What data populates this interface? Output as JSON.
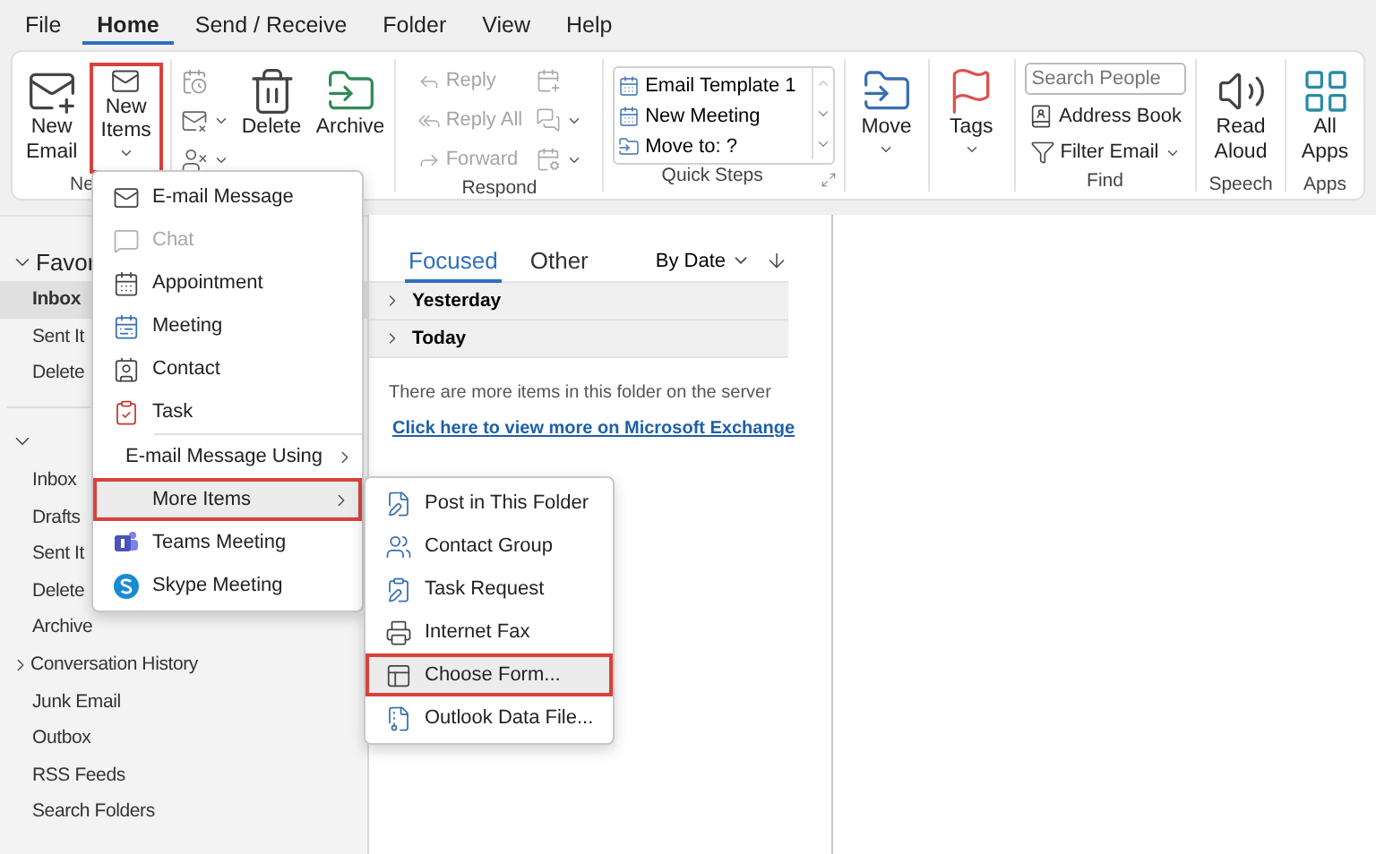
{
  "menu_bar": [
    {
      "label": "File",
      "selected": false
    },
    {
      "label": "Home",
      "selected": true
    },
    {
      "label": "Send / Receive",
      "selected": false
    },
    {
      "label": "Folder",
      "selected": false
    },
    {
      "label": "View",
      "selected": false
    },
    {
      "label": "Help",
      "selected": false
    }
  ],
  "ribbon": {
    "new": {
      "label": "Ne",
      "buttons": [
        {
          "label": "New Email",
          "dropdown": false,
          "highlighted": false
        },
        {
          "label": "New Items",
          "dropdown": true,
          "highlighted": true
        }
      ]
    },
    "delete": {
      "buttons": [
        {
          "label": "Delete"
        },
        {
          "label": "Archive"
        }
      ]
    },
    "respond": {
      "label": "Respond",
      "buttons": [
        {
          "label": "Reply",
          "disabled": true
        },
        {
          "label": "Reply All",
          "disabled": true
        },
        {
          "label": "Forward",
          "disabled": true
        }
      ]
    },
    "quick_steps": {
      "label": "Quick Steps",
      "items": [
        "Email Template 1",
        "New Meeting",
        "Move to: ?"
      ]
    },
    "move": {
      "button": "Move"
    },
    "tags": {
      "button": "Tags"
    },
    "find": {
      "label": "Find",
      "search": {
        "placeholder": "Search People"
      },
      "buttons": [
        {
          "label": "Address Book",
          "dropdown": false
        },
        {
          "label": "Filter Email",
          "dropdown": true
        }
      ]
    },
    "speech": {
      "label": "Speech",
      "button": "Read Aloud"
    },
    "apps": {
      "label": "Apps",
      "button": "All Apps"
    }
  },
  "sidebar": {
    "favorites": {
      "label": "Favor",
      "expanded": true,
      "items": [
        {
          "label": "Inbox",
          "selected": true,
          "expandable": false
        },
        {
          "label": "Sent It",
          "selected": false,
          "expandable": false
        },
        {
          "label": "Delete",
          "selected": false,
          "expandable": false
        }
      ]
    },
    "account": {
      "expanded": true,
      "items": [
        {
          "label": "Inbox",
          "selected": false,
          "expandable": false
        },
        {
          "label": "Drafts",
          "selected": false,
          "expandable": false
        },
        {
          "label": "Sent It",
          "selected": false,
          "expandable": false
        },
        {
          "label": "Delete",
          "selected": false,
          "expandable": false
        },
        {
          "label": "Archive",
          "selected": false,
          "expandable": false
        },
        {
          "label": "Conversation History",
          "selected": false,
          "expandable": true
        },
        {
          "label": "Junk Email",
          "selected": false,
          "expandable": false
        },
        {
          "label": "Outbox",
          "selected": false,
          "expandable": false
        },
        {
          "label": "RSS Feeds",
          "selected": false,
          "expandable": false
        },
        {
          "label": "Search Folders",
          "selected": false,
          "expandable": false
        }
      ]
    }
  },
  "message_list": {
    "tabs": [
      {
        "label": "Focused",
        "selected": true
      },
      {
        "label": "Other",
        "selected": false
      }
    ],
    "sort": "By Date",
    "groups": [
      {
        "label": "Yesterday",
        "expanded": false
      },
      {
        "label": "Today",
        "expanded": false
      }
    ],
    "notice": "There are more items in this folder on the server",
    "link": "Click here to view more on Microsoft Exchange"
  },
  "new_items_menu": {
    "items": [
      {
        "label": "E-mail Message",
        "disabled": false,
        "highlighted": false,
        "submenu": false
      },
      {
        "label": "Chat",
        "disabled": true,
        "highlighted": false,
        "submenu": false
      },
      {
        "label": "Appointment",
        "disabled": false,
        "highlighted": false,
        "submenu": false
      },
      {
        "label": "Meeting",
        "disabled": false,
        "highlighted": false,
        "submenu": false
      },
      {
        "label": "Contact",
        "disabled": false,
        "highlighted": false,
        "submenu": false
      },
      {
        "label": "Task",
        "disabled": false,
        "highlighted": false,
        "submenu": false
      },
      {
        "label": "E-mail Message Using",
        "disabled": false,
        "highlighted": false,
        "submenu": true
      },
      {
        "label": "More Items",
        "disabled": false,
        "highlighted": true,
        "submenu": true
      },
      {
        "label": "Teams Meeting",
        "disabled": false,
        "highlighted": false,
        "submenu": false
      },
      {
        "label": "Skype Meeting",
        "disabled": false,
        "highlighted": false,
        "submenu": false
      }
    ]
  },
  "more_items_menu": {
    "items": [
      {
        "label": "Post in This Folder",
        "highlighted": false
      },
      {
        "label": "Contact Group",
        "highlighted": false
      },
      {
        "label": "Task Request",
        "highlighted": false
      },
      {
        "label": "Internet Fax",
        "highlighted": false
      },
      {
        "label": "Choose Form...",
        "highlighted": true
      },
      {
        "label": "Outlook Data File...",
        "highlighted": false
      }
    ]
  }
}
